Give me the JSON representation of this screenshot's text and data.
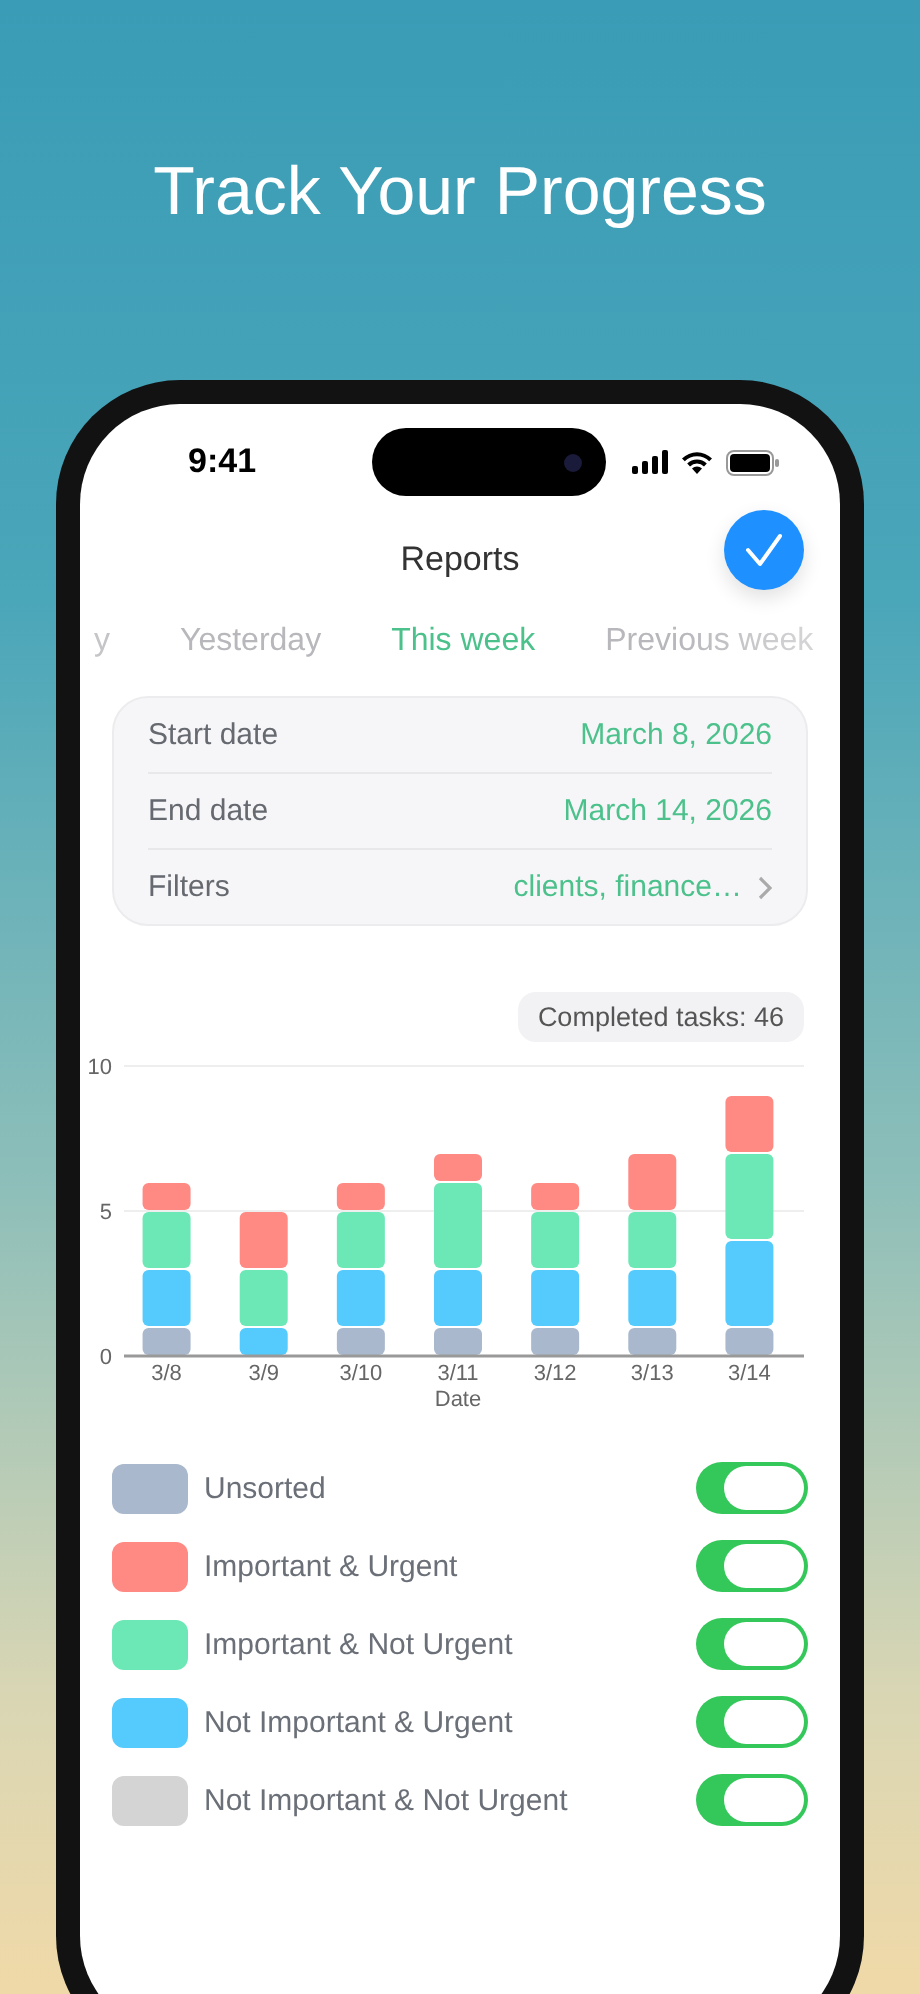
{
  "header": {
    "title": "Track Your Progress"
  },
  "status_bar": {
    "time": "9:41"
  },
  "nav": {
    "title": "Reports"
  },
  "tabs": [
    {
      "label": "y",
      "selected": false
    },
    {
      "label": "Yesterday",
      "selected": false
    },
    {
      "label": "This week",
      "selected": true
    },
    {
      "label": "Previous week",
      "selected": false
    }
  ],
  "date_card": {
    "rows": [
      {
        "label": "Start date",
        "value": "March 8, 2026",
        "kind": "value"
      },
      {
        "label": "End date",
        "value": "March 14, 2026",
        "kind": "value"
      },
      {
        "label": "Filters",
        "value": "clients, finance…",
        "kind": "link"
      }
    ]
  },
  "completed_badge": "Completed tasks: 46",
  "chart_data": {
    "type": "bar",
    "stacked": true,
    "xlabel": "Date",
    "categories": [
      "3/8",
      "3/9",
      "3/10",
      "3/11",
      "3/12",
      "3/13",
      "3/14"
    ],
    "ylim": [
      0,
      10
    ],
    "yticks": [
      0,
      5,
      10
    ],
    "series": [
      {
        "color": "#a9b8cc",
        "values": [
          1,
          0,
          1,
          1,
          1,
          1,
          1
        ]
      },
      {
        "color": "#55cbfd",
        "values": [
          2,
          1,
          2,
          2,
          2,
          2,
          3
        ]
      },
      {
        "color": "#6ce8b6",
        "values": [
          2,
          2,
          2,
          3,
          2,
          2,
          3
        ]
      },
      {
        "color": "#ff8a84",
        "values": [
          1,
          2,
          1,
          1,
          1,
          2,
          2
        ]
      }
    ]
  },
  "legend": [
    {
      "label": "Unsorted",
      "color": "#a9b8cc",
      "on": true
    },
    {
      "label": "Important & Urgent",
      "color": "#ff8a84",
      "on": true
    },
    {
      "label": "Important & Not Urgent",
      "color": "#6ce8b6",
      "on": true
    },
    {
      "label": "Not Important & Urgent",
      "color": "#55cbfd",
      "on": true
    },
    {
      "label": "Not Important & Not Urgent",
      "color": "#d4d4d4",
      "on": true
    }
  ]
}
